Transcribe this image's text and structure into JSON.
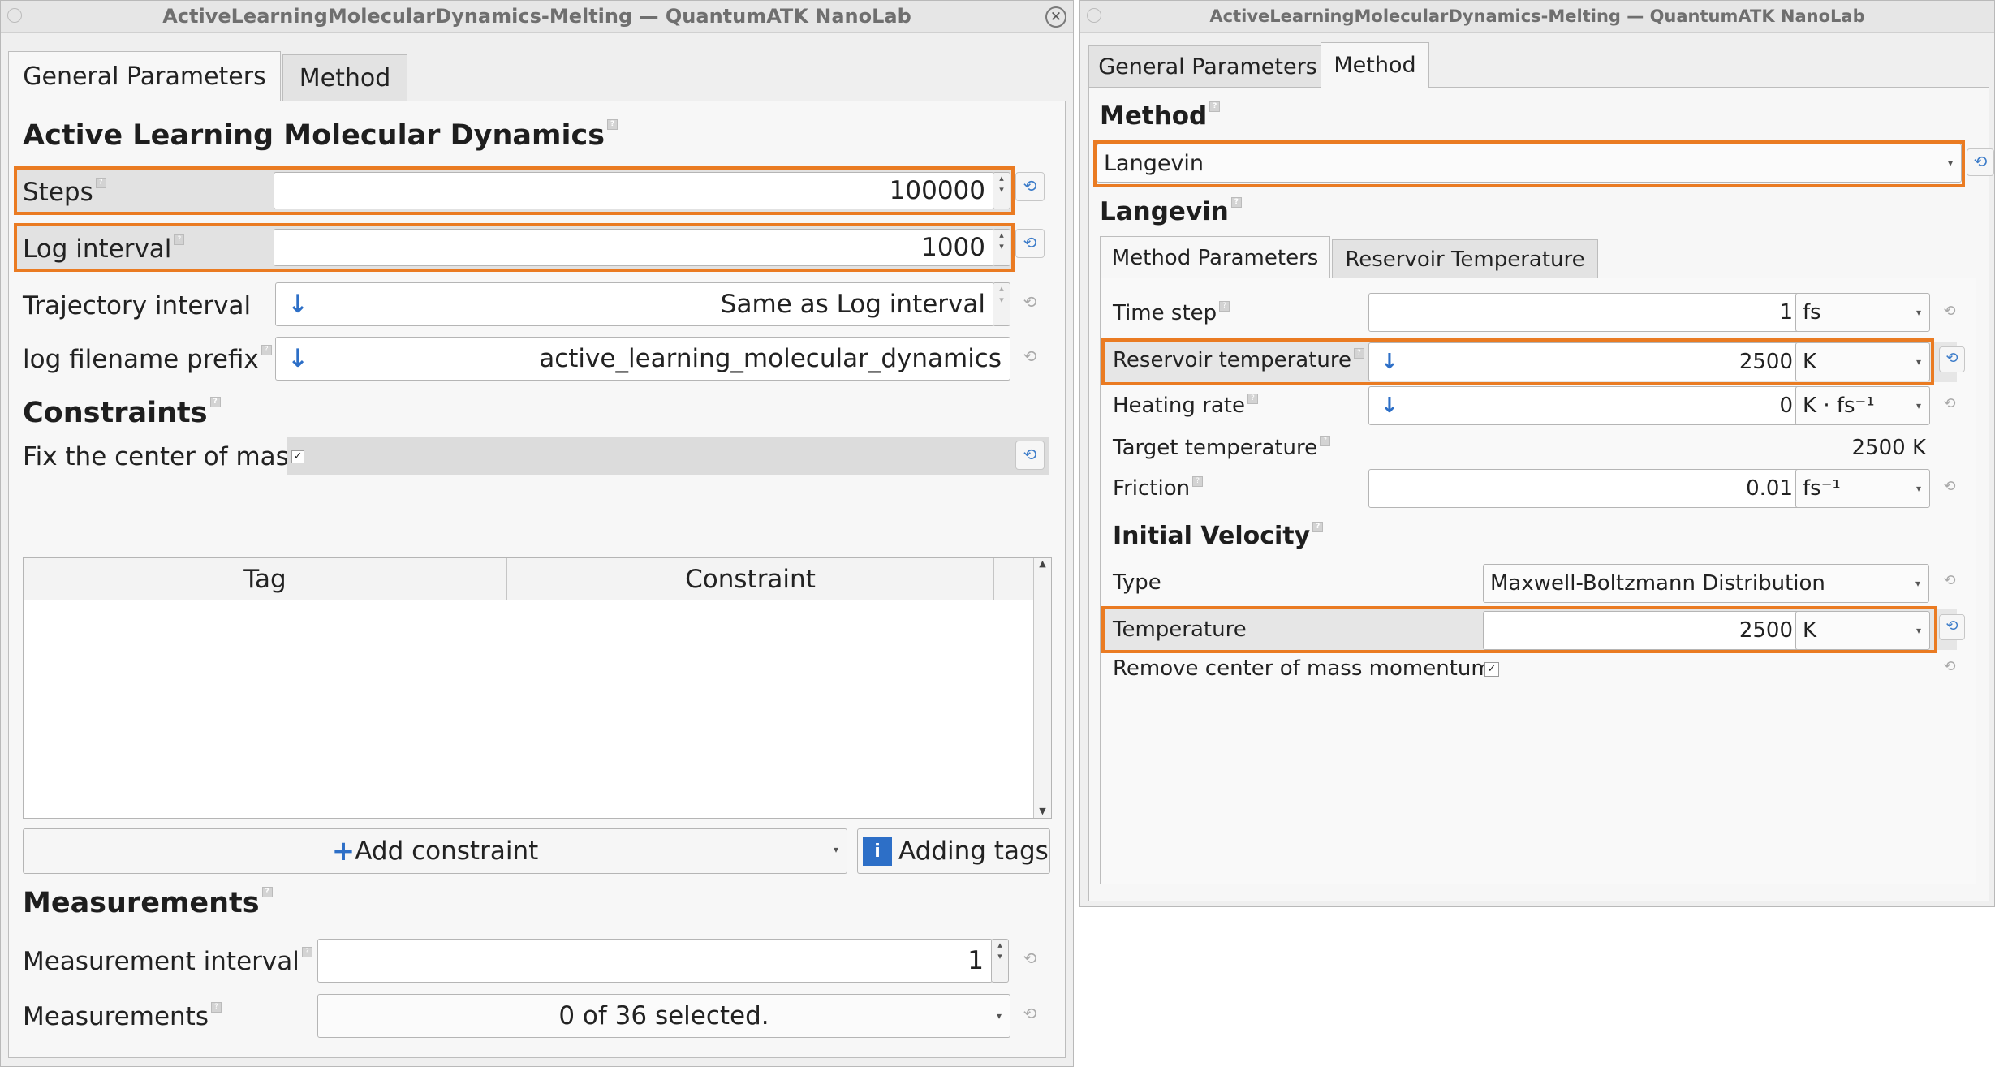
{
  "left_window": {
    "title": "ActiveLearningMolecularDynamics-Melting — QuantumATK NanoLab",
    "tabs": [
      "General Parameters",
      "Method"
    ],
    "section_aldm": "Active Learning Molecular Dynamics",
    "steps_label": "Steps",
    "steps_value": "100000",
    "log_interval_label": "Log interval",
    "log_interval_value": "1000",
    "trajectory_interval_label": "Trajectory interval",
    "trajectory_interval_value": "Same as Log interval",
    "log_prefix_label": "log filename prefix",
    "log_prefix_value": "active_learning_molecular_dynamics",
    "section_constraints": "Constraints",
    "fix_com_label": "Fix the center of mass",
    "fix_com_checked": true,
    "table_headers": [
      "Tag",
      "Constraint"
    ],
    "add_constraint_label": "Add constraint",
    "adding_tags_label": "Adding tags",
    "section_measurements": "Measurements",
    "measurement_interval_label": "Measurement interval",
    "measurement_interval_value": "1",
    "measurements_label": "Measurements",
    "measurements_value": "0 of 36 selected."
  },
  "right_window": {
    "title": "ActiveLearningMolecularDynamics-Melting — QuantumATK NanoLab",
    "tabs": [
      "General Parameters",
      "Method"
    ],
    "section_method": "Method",
    "method_value": "Langevin",
    "section_langevin": "Langevin",
    "subtabs": [
      "Method Parameters",
      "Reservoir Temperature"
    ],
    "time_step_label": "Time step",
    "time_step_value": "1",
    "time_step_unit": "fs",
    "reservoir_temp_label": "Reservoir temperature",
    "reservoir_temp_value": "2500",
    "reservoir_temp_unit": "K",
    "heating_rate_label": "Heating rate",
    "heating_rate_value": "0",
    "heating_rate_unit": "K · fs⁻¹",
    "target_temp_label": "Target temperature",
    "target_temp_value": "2500 K",
    "friction_label": "Friction",
    "friction_value": "0.01",
    "friction_unit": "fs⁻¹",
    "section_initial_velocity": "Initial Velocity",
    "type_label": "Type",
    "type_value": "Maxwell-Boltzmann Distribution",
    "temperature_label": "Temperature",
    "temperature_value": "2500",
    "temperature_unit": "K",
    "remove_com_label": "Remove center of mass momentum",
    "remove_com_checked": true
  },
  "colors": {
    "highlight": "#ea7b22",
    "accent": "#2d6fc7"
  },
  "icons": {
    "reset": "reset-icon",
    "help": "help-icon",
    "arrow": "inherit-arrow-icon",
    "info": "info-icon"
  }
}
